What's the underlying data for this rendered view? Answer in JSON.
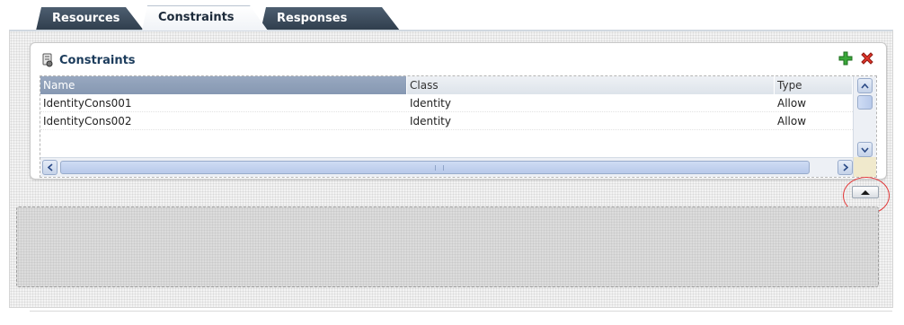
{
  "tabs": [
    {
      "label": "Resources",
      "active": false
    },
    {
      "label": "Constraints",
      "active": true
    },
    {
      "label": "Responses",
      "active": false
    }
  ],
  "panel": {
    "title": "Constraints",
    "icon": "constraint-icon",
    "actions": [
      {
        "name": "add",
        "icon": "plus-icon",
        "color": "#2e9b2e"
      },
      {
        "name": "delete",
        "icon": "x-icon",
        "color": "#d82b1e"
      }
    ]
  },
  "table": {
    "columns": [
      "Name",
      "Class",
      "Type"
    ],
    "rows": [
      [
        "IdentityCons001",
        "Identity",
        "Allow"
      ],
      [
        "IdentityCons002",
        "Identity",
        "Allow"
      ]
    ],
    "selected_header": "Name"
  },
  "splitter": {
    "icon": "collapse-up-icon",
    "highlight_color": "#e33a3a"
  }
}
